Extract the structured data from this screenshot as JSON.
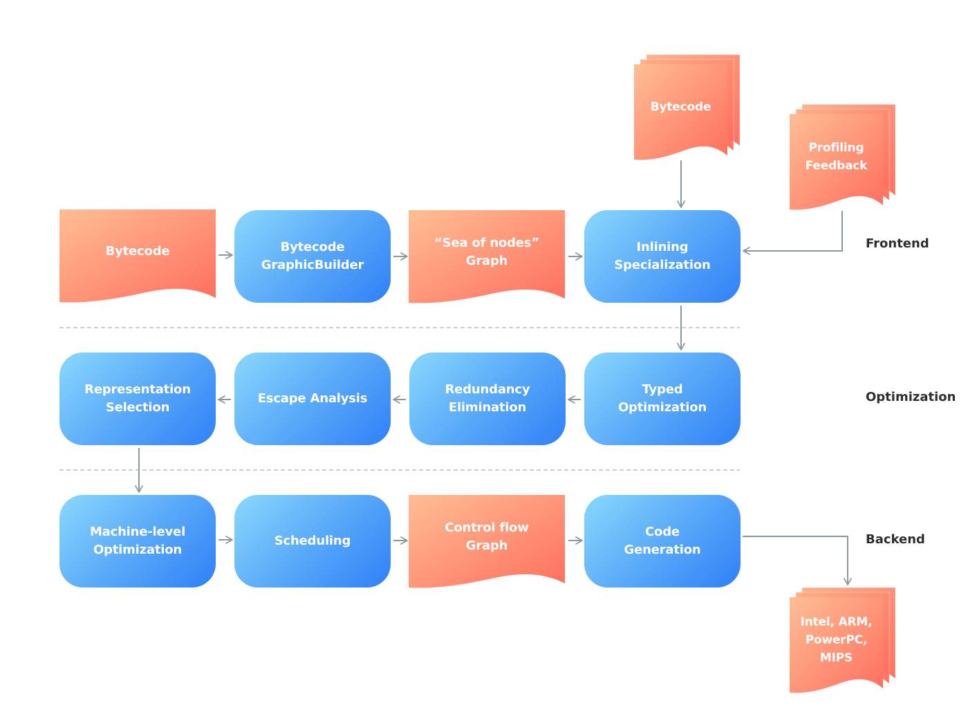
{
  "colors": {
    "process_gradient": [
      "#8ad8fd",
      "#2f80f8"
    ],
    "document_gradient": [
      "#ffbe95",
      "#ff6e5e"
    ],
    "connector": "#8a979f",
    "divider": "#c9ced2",
    "section_text": "#2e2e2e",
    "node_text": "#ffffff"
  },
  "sections": [
    {
      "id": "frontend",
      "label": "Frontend"
    },
    {
      "id": "optimization",
      "label": "Optimization"
    },
    {
      "id": "backend",
      "label": "Backend"
    }
  ],
  "nodes": [
    {
      "id": "bytecode-input",
      "type": "document",
      "label": "Bytecode"
    },
    {
      "id": "bytecode-graphic-builder",
      "type": "process",
      "label": "Bytecode\nGraphicBuilder"
    },
    {
      "id": "sea-of-nodes-graph",
      "type": "document",
      "label": "“Sea of nodes”\nGraph"
    },
    {
      "id": "inlining-specialization",
      "type": "process",
      "label": "Inlining\nSpecialization"
    },
    {
      "id": "bytecode-external",
      "type": "multi-document",
      "label": "Bytecode"
    },
    {
      "id": "profiling-feedback",
      "type": "multi-document",
      "label": "Profiling\nFeedback"
    },
    {
      "id": "typed-optimization",
      "type": "process",
      "label": "Typed\nOptimization"
    },
    {
      "id": "redundancy-elimination",
      "type": "process",
      "label": "Redundancy\nElimination"
    },
    {
      "id": "escape-analysis",
      "type": "process",
      "label": "Escape Analysis"
    },
    {
      "id": "representation-selection",
      "type": "process",
      "label": "Representation\nSelection"
    },
    {
      "id": "machine-level-optimization",
      "type": "process",
      "label": "Machine-level\nOptimization"
    },
    {
      "id": "scheduling",
      "type": "process",
      "label": "Scheduling"
    },
    {
      "id": "control-flow-graph",
      "type": "document",
      "label": "Control flow\nGraph"
    },
    {
      "id": "code-generation",
      "type": "process",
      "label": "Code\nGeneration"
    },
    {
      "id": "target-architectures",
      "type": "multi-document",
      "label": "Intel, ARM,\nPowerPC,\nMIPS"
    }
  ],
  "edges": [
    {
      "from": "bytecode-input",
      "to": "bytecode-graphic-builder"
    },
    {
      "from": "bytecode-graphic-builder",
      "to": "sea-of-nodes-graph"
    },
    {
      "from": "sea-of-nodes-graph",
      "to": "inlining-specialization"
    },
    {
      "from": "bytecode-external",
      "to": "inlining-specialization"
    },
    {
      "from": "profiling-feedback",
      "to": "inlining-specialization"
    },
    {
      "from": "inlining-specialization",
      "to": "typed-optimization"
    },
    {
      "from": "typed-optimization",
      "to": "redundancy-elimination"
    },
    {
      "from": "redundancy-elimination",
      "to": "escape-analysis"
    },
    {
      "from": "escape-analysis",
      "to": "representation-selection"
    },
    {
      "from": "representation-selection",
      "to": "machine-level-optimization"
    },
    {
      "from": "machine-level-optimization",
      "to": "scheduling"
    },
    {
      "from": "scheduling",
      "to": "control-flow-graph"
    },
    {
      "from": "control-flow-graph",
      "to": "code-generation"
    },
    {
      "from": "code-generation",
      "to": "target-architectures"
    }
  ]
}
